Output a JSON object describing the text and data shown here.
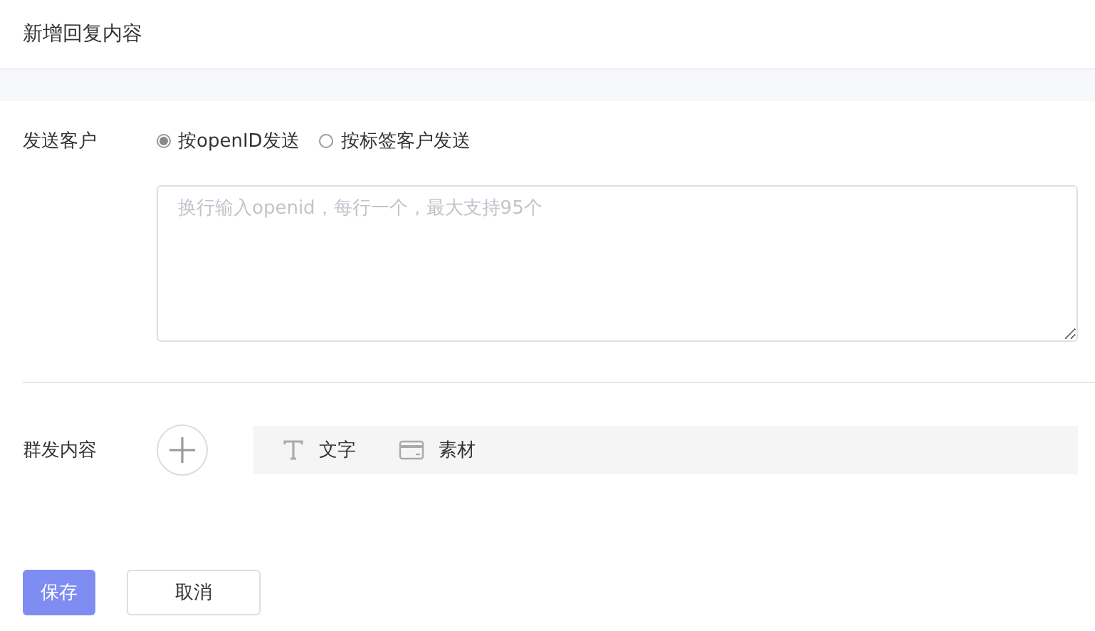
{
  "header": {
    "title": "新增回复内容"
  },
  "send_to": {
    "label": "发送客户",
    "options": [
      {
        "label": "按openID发送",
        "selected": true
      },
      {
        "label": "按标签客户发送",
        "selected": false
      }
    ],
    "textarea": {
      "placeholder": "换行输入openid，每行一个，最大支持95个"
    }
  },
  "content": {
    "label": "群发内容",
    "types": [
      {
        "kind": "text",
        "label": "文字"
      },
      {
        "kind": "material",
        "label": "素材"
      }
    ]
  },
  "buttons": [
    {
      "kind": "primary",
      "label": "保存"
    },
    {
      "kind": "default",
      "label": "取消"
    }
  ]
}
